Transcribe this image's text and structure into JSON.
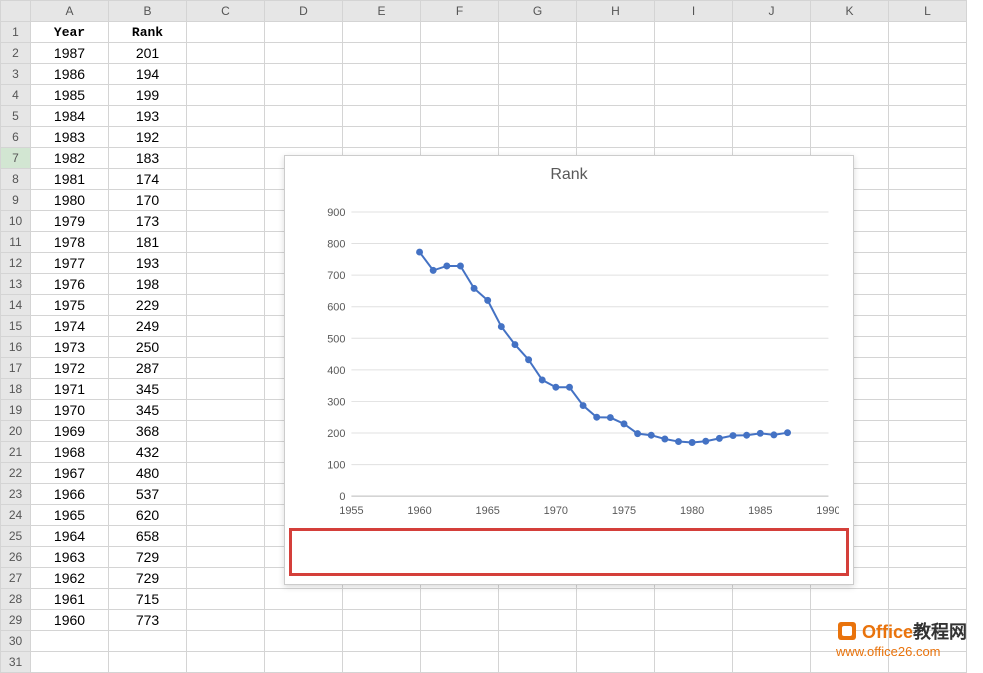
{
  "columns": [
    "A",
    "B",
    "C",
    "D",
    "E",
    "F",
    "G",
    "H",
    "I",
    "J",
    "K",
    "L"
  ],
  "headers": {
    "A": "Year",
    "B": "Rank"
  },
  "selected_row": 7,
  "rows": [
    {
      "n": 1,
      "a": "Year",
      "b": "Rank",
      "hdr": true
    },
    {
      "n": 2,
      "a": "1987",
      "b": "201"
    },
    {
      "n": 3,
      "a": "1986",
      "b": "194"
    },
    {
      "n": 4,
      "a": "1985",
      "b": "199"
    },
    {
      "n": 5,
      "a": "1984",
      "b": "193"
    },
    {
      "n": 6,
      "a": "1983",
      "b": "192"
    },
    {
      "n": 7,
      "a": "1982",
      "b": "183"
    },
    {
      "n": 8,
      "a": "1981",
      "b": "174"
    },
    {
      "n": 9,
      "a": "1980",
      "b": "170"
    },
    {
      "n": 10,
      "a": "1979",
      "b": "173"
    },
    {
      "n": 11,
      "a": "1978",
      "b": "181"
    },
    {
      "n": 12,
      "a": "1977",
      "b": "193"
    },
    {
      "n": 13,
      "a": "1976",
      "b": "198"
    },
    {
      "n": 14,
      "a": "1975",
      "b": "229"
    },
    {
      "n": 15,
      "a": "1974",
      "b": "249"
    },
    {
      "n": 16,
      "a": "1973",
      "b": "250"
    },
    {
      "n": 17,
      "a": "1972",
      "b": "287"
    },
    {
      "n": 18,
      "a": "1971",
      "b": "345"
    },
    {
      "n": 19,
      "a": "1970",
      "b": "345"
    },
    {
      "n": 20,
      "a": "1969",
      "b": "368"
    },
    {
      "n": 21,
      "a": "1968",
      "b": "432"
    },
    {
      "n": 22,
      "a": "1967",
      "b": "480"
    },
    {
      "n": 23,
      "a": "1966",
      "b": "537"
    },
    {
      "n": 24,
      "a": "1965",
      "b": "620"
    },
    {
      "n": 25,
      "a": "1964",
      "b": "658"
    },
    {
      "n": 26,
      "a": "1963",
      "b": "729"
    },
    {
      "n": 27,
      "a": "1962",
      "b": "729"
    },
    {
      "n": 28,
      "a": "1961",
      "b": "715"
    },
    {
      "n": 29,
      "a": "1960",
      "b": "773"
    },
    {
      "n": 30,
      "a": "",
      "b": ""
    },
    {
      "n": 31,
      "a": "",
      "b": ""
    }
  ],
  "chart_data": {
    "type": "scatter-line",
    "title": "Rank",
    "xlabel": "",
    "ylabel": "",
    "xlim": [
      1955,
      1990
    ],
    "ylim": [
      0,
      900
    ],
    "xticks": [
      1955,
      1960,
      1965,
      1970,
      1975,
      1980,
      1985,
      1990
    ],
    "yticks": [
      0,
      100,
      200,
      300,
      400,
      500,
      600,
      700,
      800,
      900
    ],
    "series": [
      {
        "name": "Rank",
        "color": "#4472c4",
        "points": [
          {
            "x": 1960,
            "y": 773
          },
          {
            "x": 1961,
            "y": 715
          },
          {
            "x": 1962,
            "y": 729
          },
          {
            "x": 1963,
            "y": 729
          },
          {
            "x": 1964,
            "y": 658
          },
          {
            "x": 1965,
            "y": 620
          },
          {
            "x": 1966,
            "y": 537
          },
          {
            "x": 1967,
            "y": 480
          },
          {
            "x": 1968,
            "y": 432
          },
          {
            "x": 1969,
            "y": 368
          },
          {
            "x": 1970,
            "y": 345
          },
          {
            "x": 1971,
            "y": 345
          },
          {
            "x": 1972,
            "y": 287
          },
          {
            "x": 1973,
            "y": 250
          },
          {
            "x": 1974,
            "y": 249
          },
          {
            "x": 1975,
            "y": 229
          },
          {
            "x": 1976,
            "y": 198
          },
          {
            "x": 1977,
            "y": 193
          },
          {
            "x": 1978,
            "y": 181
          },
          {
            "x": 1979,
            "y": 173
          },
          {
            "x": 1980,
            "y": 170
          },
          {
            "x": 1981,
            "y": 174
          },
          {
            "x": 1982,
            "y": 183
          },
          {
            "x": 1983,
            "y": 192
          },
          {
            "x": 1984,
            "y": 193
          },
          {
            "x": 1985,
            "y": 199
          },
          {
            "x": 1986,
            "y": 194
          },
          {
            "x": 1987,
            "y": 201
          }
        ]
      }
    ]
  },
  "watermark": {
    "line1_prefix": "Office",
    "line1_suffix": "教程网",
    "line2": "www.office26.com"
  }
}
